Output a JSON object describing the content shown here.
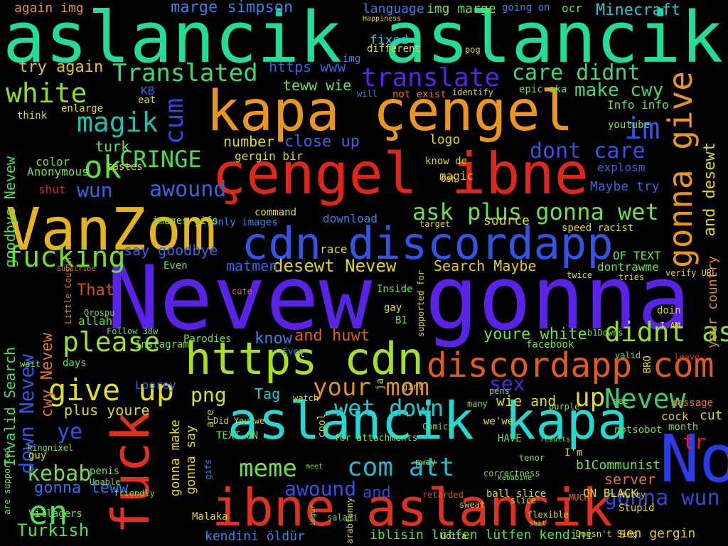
{
  "title": "word cloud",
  "words": [
    "aslancik aslancik",
    "kapa çengel",
    "çengel ibne",
    "VanZom",
    "cdn discordapp",
    "Nevew gonna",
    "https cdn",
    "discordapp com",
    "aslancik kapa",
    "ibne aslancik",
    "fuck",
    "No",
    "gonna give",
    "white",
    "magik",
    "ok",
    "CRINGE",
    "fucking",
    "please",
    "give up",
    "Translated",
    "translate",
    "care didnt",
    "make cwy",
    "im",
    "dont care",
    "ask plus gonna wet",
    "didnt ask",
    "your mom",
    "Nevew",
    "wet down",
    "com att",
    "meme",
    "awound",
    "gonna wun",
    "en",
    "kebab",
    "Turkish",
    "gonna teww",
    "kendini öldür",
    "iblisin lütfen lütfen kendini",
    "awound",
    "wun",
    "cum",
    "marge simpson",
    "Minecraft",
    "again img",
    "try again",
    "desewt Nevew",
    "Search Maybe",
    "say goodbye",
    "matmen",
    "and huwt",
    "know",
    "youre white",
    "sex",
    "up",
    "wie and",
    "png",
    "Tag",
    "down Nevew",
    "cwy Nevew",
    "goodbye Nevew",
    "Invalid Search",
    "ye",
    "plus youre",
    "server",
    "ON BLACK",
    "b1Communist",
    "sen gergin",
    "cock",
    "cut",
    "tr",
    "and desewt",
    "your country",
    "close up",
    "number",
    "gergin bir",
    "teww wie",
    "https www",
    "logo",
    "source",
    "magic",
    "Maybe try",
    "explosm",
    "OF TEXT",
    "dontrawme",
    "facebook",
    "That",
    "Only images",
    "command",
    "download",
    "images gifs",
    "KB",
    "eat",
    "enlarge",
    "think",
    "turk",
    "color",
    "Anonymous",
    "shut",
    "fixed",
    "language",
    "img marge",
    "ocr",
    "Info info",
    "youtube",
    "epic aka",
    "gonna make",
    "gonna say",
    "Loorey",
    "penis",
    "guy",
    "and",
    "month",
    "message",
    "HAVE",
    "I'm",
    "Malaka",
    "MUCH",
    "notsobot",
    "TEXT ON",
    "B1",
    "gay",
    "ball slice",
    "allah",
    "race",
    "BRO",
    "for attachments",
    "Even",
    "Orospu",
    "going on",
    "Happiness",
    "different",
    "pog",
    "img",
    "will",
    "not exist",
    "identify",
    "know de",
    "tastes",
    "Ooh",
    "target",
    "speed racist",
    "verify URL",
    "twice",
    "tries",
    "doin",
    "I AM",
    "Villagers",
    "Unable",
    "friendly",
    "kingnixel",
    "are supported",
    "Little Cousin",
    "Subscribe",
    "Instagram",
    "days",
    "wait",
    "Parodies",
    "Follow 38w",
    "el",
    "girl",
    "cute",
    "Inside",
    "supported for",
    "pens",
    "valid",
    "b1Downs",
    "leave",
    "Stupid",
    "purple",
    "see",
    "many",
    "correctness",
    "results",
    "tenor",
    "Gotta",
    "retarded",
    "salami",
    "imgur",
    "meet",
    "pway",
    "cool",
    "ja",
    "we'we",
    "arabfunny",
    "Comics",
    "sweat",
    "kebabine",
    "are",
    "gifs",
    "Did You'we",
    "watch",
    "Even",
    "slice",
    "flexible",
    "shit",
    "Doesn't Sing",
    "Nutty"
  ]
}
